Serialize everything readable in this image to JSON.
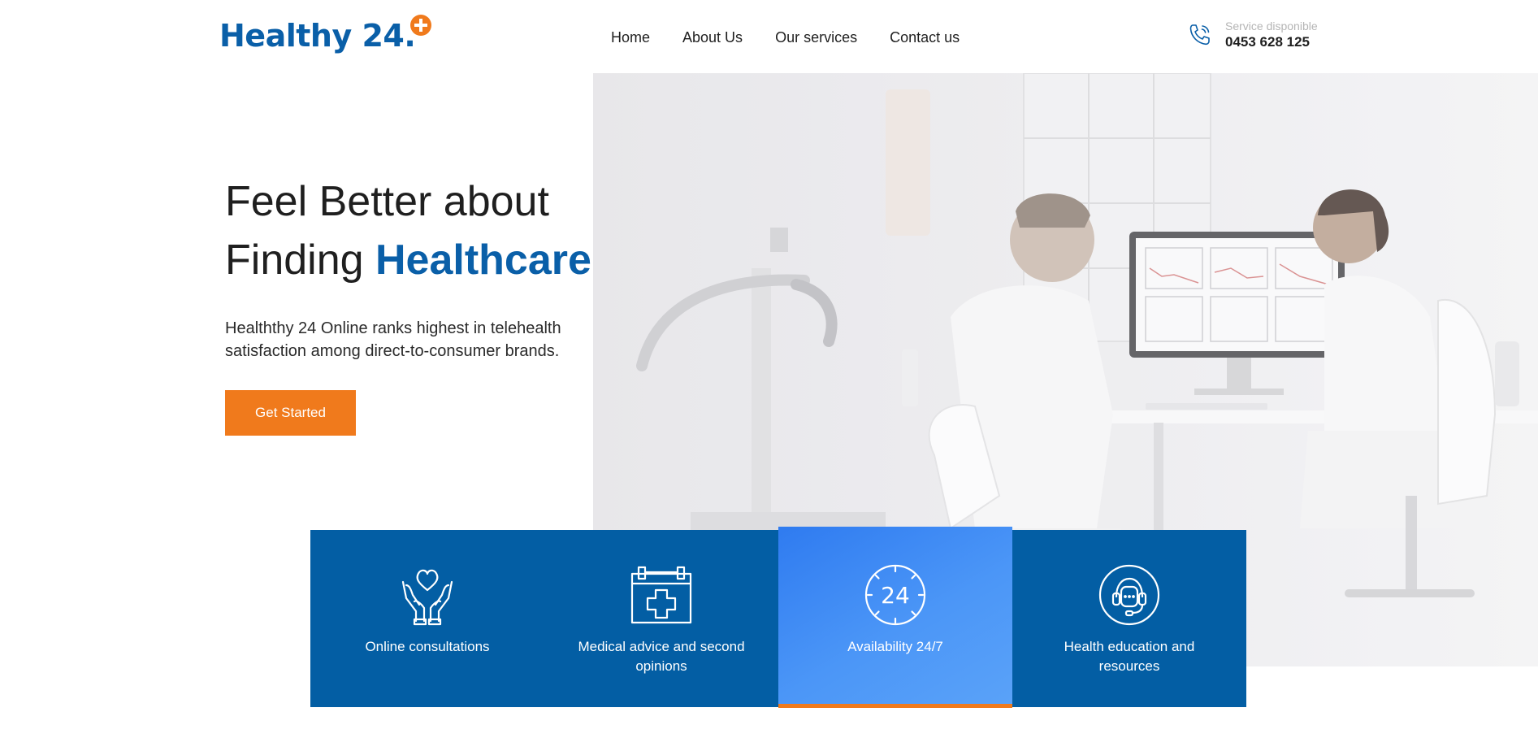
{
  "brand": {
    "name": "Healthy 24.",
    "accent_color": "#f07a1c",
    "primary_color": "#0a5fa8"
  },
  "nav": {
    "items": [
      {
        "label": "Home"
      },
      {
        "label": "About Us"
      },
      {
        "label": "Our services"
      },
      {
        "label": "Contact us"
      }
    ]
  },
  "contact": {
    "icon": "phone-icon",
    "label": "Service disponible",
    "number": "0453 628 125"
  },
  "hero": {
    "title_line1": "Feel Better about",
    "title_line2_plain": "Finding ",
    "title_line2_accent": "Healthcare",
    "description": "Healththy 24 Online ranks highest in telehealth satisfaction among direct-to-consumer brands.",
    "cta_label": "Get Started"
  },
  "services": {
    "background_color": "#035ea4",
    "items": [
      {
        "label": "Online consultations",
        "icon": "hands-heart-icon",
        "active": false
      },
      {
        "label": "Medical advice and second opinions",
        "icon": "medical-kit-icon",
        "active": false
      },
      {
        "label": "Availability 24/7",
        "icon": "clock-24-icon",
        "active": true,
        "clock_text": "24"
      },
      {
        "label": "Health education and resources",
        "icon": "headset-support-icon",
        "active": false
      }
    ]
  }
}
